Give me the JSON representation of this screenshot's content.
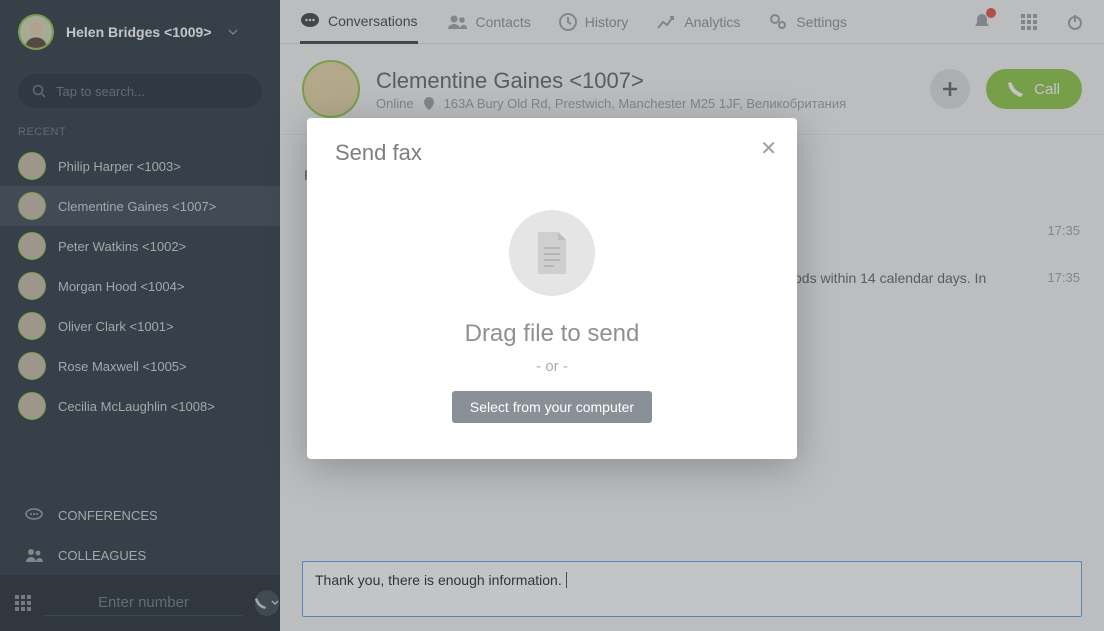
{
  "user": {
    "name": "Helen Bridges <1009>"
  },
  "search": {
    "placeholder": "Tap to search..."
  },
  "recent_label": "RECENT",
  "recent": [
    {
      "label": "Philip Harper <1003>"
    },
    {
      "label": "Clementine Gaines <1007>",
      "active": true
    },
    {
      "label": "Peter Watkins <1002>"
    },
    {
      "label": "Morgan Hood <1004>"
    },
    {
      "label": "Oliver Clark <1001>"
    },
    {
      "label": "Rose Maxwell <1005>"
    },
    {
      "label": "Cecilia McLaughlin <1008>"
    }
  ],
  "sections": {
    "conferences": "CONFERENCES",
    "colleagues": "COLLEAGUES"
  },
  "footer": {
    "placeholder": "Enter number"
  },
  "tabs": {
    "conversations": "Conversations",
    "contacts": "Contacts",
    "history": "History",
    "analytics": "Analytics",
    "settings": "Settings"
  },
  "contact": {
    "name": "Clementine Gaines <1007>",
    "status": "Online",
    "address": "163A Bury Old Rd, Prestwich, Manchester M25 1JF, Великобритания",
    "call_label": "Call"
  },
  "messages": {
    "row1_text": "",
    "row1_time": "17:35",
    "row2_text": "ods within 14 calendar days. In",
    "row2_time": "17:35",
    "date_marker": "F"
  },
  "compose": {
    "text": "Thank you, there is enough information."
  },
  "modal": {
    "title": "Send fax",
    "drag_text": "Drag file to send",
    "or_text": "- or -",
    "select_button": "Select from your computer"
  }
}
